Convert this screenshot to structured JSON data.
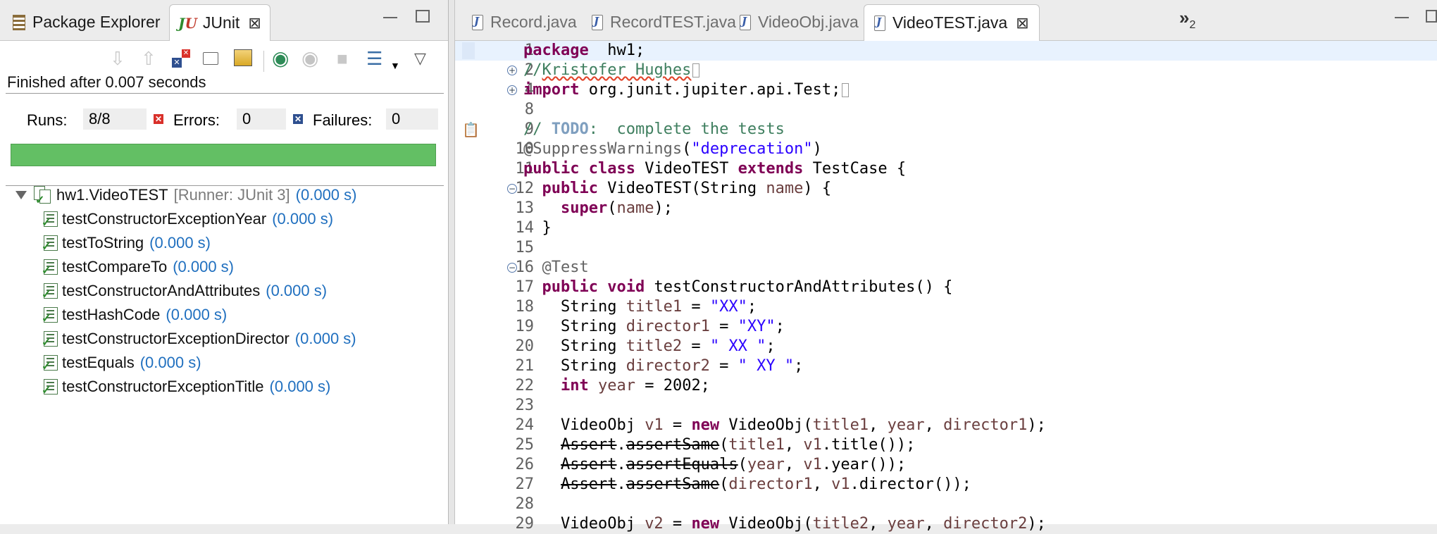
{
  "left_panel": {
    "tabs": [
      {
        "label": "Package Explorer",
        "icon": "package-explorer-icon"
      },
      {
        "label": "JUnit",
        "icon": "junit-icon",
        "active": true
      }
    ],
    "status": "Finished after 0.007 seconds",
    "counters": {
      "runs_label": "Runs:",
      "runs_value": "8/8",
      "errors_label": "Errors:",
      "errors_value": "0",
      "failures_label": "Failures:",
      "failures_value": "0"
    },
    "progress_color": "#63bf64",
    "progress_fraction": 1.0,
    "suite": {
      "name": "hw1.VideoTEST",
      "runner": "[Runner: JUnit 3]",
      "time": "(0.000 s)"
    },
    "tests": [
      {
        "name": "testConstructorExceptionYear",
        "time": "(0.000 s)"
      },
      {
        "name": "testToString",
        "time": "(0.000 s)"
      },
      {
        "name": "testCompareTo",
        "time": "(0.000 s)"
      },
      {
        "name": "testConstructorAndAttributes",
        "time": "(0.000 s)"
      },
      {
        "name": "testHashCode",
        "time": "(0.000 s)"
      },
      {
        "name": "testConstructorExceptionDirector",
        "time": "(0.000 s)"
      },
      {
        "name": "testEquals",
        "time": "(0.000 s)"
      },
      {
        "name": "testConstructorExceptionTitle",
        "time": "(0.000 s)"
      }
    ]
  },
  "editor": {
    "tabs": [
      {
        "label": "Record.java"
      },
      {
        "label": "RecordTEST.java"
      },
      {
        "label": "VideoObj.java"
      },
      {
        "label": "VideoTEST.java",
        "active": true
      }
    ],
    "overflow_label": "»",
    "overflow_count": "2",
    "lines": [
      {
        "n": "1",
        "tokens": [
          [
            "kw",
            "package"
          ],
          [
            "",
            "  hw1;"
          ]
        ]
      },
      {
        "n": "2",
        "fold": "+",
        "tokens": [
          [
            "cm",
            "//"
          ],
          [
            "cm squig",
            "Kristofer Hughes"
          ]
        ],
        "collapsed": true
      },
      {
        "n": "4",
        "fold": "+",
        "tokens": [
          [
            "kw",
            "import"
          ],
          [
            "",
            " org.junit.jupiter.api.Test;"
          ]
        ],
        "collapsed": true
      },
      {
        "n": "8",
        "tokens": []
      },
      {
        "n": "9",
        "tokens": [
          [
            "cm",
            "// "
          ],
          [
            "todo",
            "TODO"
          ],
          [
            "cm",
            ":  complete the tests"
          ]
        ]
      },
      {
        "n": "10",
        "tokens": [
          [
            "ann",
            "@SuppressWarnings"
          ],
          [
            "",
            "("
          ],
          [
            "str",
            "\"deprecation\""
          ],
          [
            "",
            ")"
          ]
        ]
      },
      {
        "n": "11",
        "tokens": [
          [
            "kw",
            "public"
          ],
          [
            "",
            " "
          ],
          [
            "kw",
            "class"
          ],
          [
            "",
            " VideoTEST "
          ],
          [
            "kw",
            "extends"
          ],
          [
            "",
            " TestCase {"
          ]
        ]
      },
      {
        "n": "12",
        "fold": "−",
        "tokens": [
          [
            "",
            "  "
          ],
          [
            "kw",
            "public"
          ],
          [
            "",
            " VideoTEST(String "
          ],
          [
            "var",
            "name"
          ],
          [
            "",
            ") {"
          ]
        ]
      },
      {
        "n": "13",
        "tokens": [
          [
            "",
            "    "
          ],
          [
            "kw",
            "super"
          ],
          [
            "",
            "("
          ],
          [
            "var",
            "name"
          ],
          [
            "",
            ");"
          ]
        ]
      },
      {
        "n": "14",
        "tokens": [
          [
            "",
            "  }"
          ]
        ]
      },
      {
        "n": "15",
        "tokens": []
      },
      {
        "n": "16",
        "fold": "−",
        "tokens": [
          [
            "",
            "  "
          ],
          [
            "ann",
            "@Test"
          ]
        ]
      },
      {
        "n": "17",
        "tokens": [
          [
            "",
            "  "
          ],
          [
            "kw",
            "public"
          ],
          [
            "",
            " "
          ],
          [
            "kw",
            "void"
          ],
          [
            "",
            " testConstructorAndAttributes() {"
          ]
        ]
      },
      {
        "n": "18",
        "tokens": [
          [
            "",
            "    String "
          ],
          [
            "var",
            "title1"
          ],
          [
            "",
            " = "
          ],
          [
            "str",
            "\"XX\""
          ],
          [
            "",
            ";"
          ]
        ]
      },
      {
        "n": "19",
        "tokens": [
          [
            "",
            "    String "
          ],
          [
            "var",
            "director1"
          ],
          [
            "",
            " = "
          ],
          [
            "str",
            "\"XY\""
          ],
          [
            "",
            ";"
          ]
        ]
      },
      {
        "n": "20",
        "tokens": [
          [
            "",
            "    String "
          ],
          [
            "var",
            "title2"
          ],
          [
            "",
            " = "
          ],
          [
            "str",
            "\" XX \""
          ],
          [
            "",
            ";"
          ]
        ]
      },
      {
        "n": "21",
        "tokens": [
          [
            "",
            "    String "
          ],
          [
            "var",
            "director2"
          ],
          [
            "",
            " = "
          ],
          [
            "str",
            "\" XY \""
          ],
          [
            "",
            ";"
          ]
        ]
      },
      {
        "n": "22",
        "tokens": [
          [
            "",
            "    "
          ],
          [
            "kw",
            "int"
          ],
          [
            "",
            " "
          ],
          [
            "var",
            "year"
          ],
          [
            "",
            " = 2002;"
          ]
        ]
      },
      {
        "n": "23",
        "tokens": []
      },
      {
        "n": "24",
        "tokens": [
          [
            "",
            "    VideoObj "
          ],
          [
            "var",
            "v1"
          ],
          [
            "",
            " = "
          ],
          [
            "kw",
            "new"
          ],
          [
            "",
            " VideoObj("
          ],
          [
            "var",
            "title1"
          ],
          [
            "",
            ", "
          ],
          [
            "var",
            "year"
          ],
          [
            "",
            ", "
          ],
          [
            "var",
            "director1"
          ],
          [
            "",
            ");"
          ]
        ]
      },
      {
        "n": "25",
        "tokens": [
          [
            "",
            "    "
          ],
          [
            "strike",
            "Assert"
          ],
          [
            "",
            "."
          ],
          [
            "strike",
            "assertSame"
          ],
          [
            "",
            "("
          ],
          [
            "var",
            "title1"
          ],
          [
            "",
            ", "
          ],
          [
            "var",
            "v1"
          ],
          [
            "",
            ".title());"
          ]
        ]
      },
      {
        "n": "26",
        "tokens": [
          [
            "",
            "    "
          ],
          [
            "strike",
            "Assert"
          ],
          [
            "",
            "."
          ],
          [
            "strike",
            "assertEquals"
          ],
          [
            "",
            "("
          ],
          [
            "var",
            "year"
          ],
          [
            "",
            ", "
          ],
          [
            "var",
            "v1"
          ],
          [
            "",
            ".year());"
          ]
        ]
      },
      {
        "n": "27",
        "tokens": [
          [
            "",
            "    "
          ],
          [
            "strike",
            "Assert"
          ],
          [
            "",
            "."
          ],
          [
            "strike",
            "assertSame"
          ],
          [
            "",
            "("
          ],
          [
            "var",
            "director1"
          ],
          [
            "",
            ", "
          ],
          [
            "var",
            "v1"
          ],
          [
            "",
            ".director());"
          ]
        ]
      },
      {
        "n": "28",
        "tokens": []
      },
      {
        "n": "29",
        "tokens": [
          [
            "",
            "    VideoObj "
          ],
          [
            "var",
            "v2"
          ],
          [
            "",
            " = "
          ],
          [
            "kw",
            "new"
          ],
          [
            "",
            " VideoObj("
          ],
          [
            "var",
            "title2"
          ],
          [
            "",
            ", "
          ],
          [
            "var",
            "year"
          ],
          [
            "",
            ", "
          ],
          [
            "var",
            "director2"
          ],
          [
            "",
            ");"
          ]
        ]
      }
    ]
  }
}
